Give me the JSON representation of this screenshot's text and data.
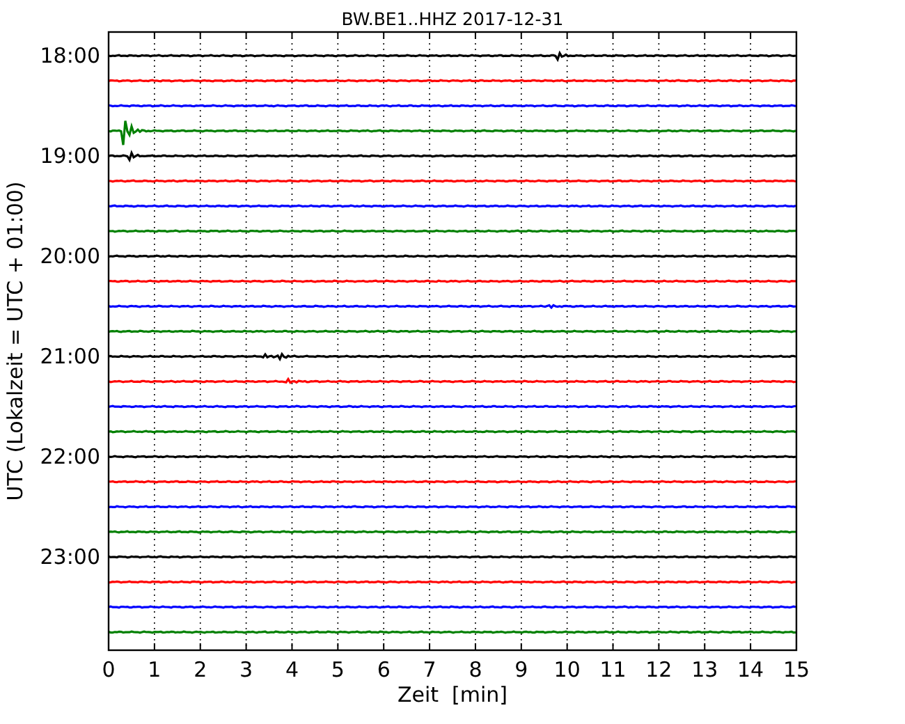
{
  "title": "BW.BE1..HHZ 2017-12-31",
  "ylabel": "UTC (Lokalzeit = UTC + 01:00)",
  "xlabel": "Zeit  [min]",
  "yticks": [
    "18:00",
    "19:00",
    "20:00",
    "21:00",
    "22:00",
    "23:00"
  ],
  "xticks": [
    "0",
    "1",
    "2",
    "3",
    "4",
    "5",
    "6",
    "7",
    "8",
    "9",
    "10",
    "11",
    "12",
    "13",
    "14",
    "15"
  ],
  "traces": [
    {
      "color": "#000000"
    },
    {
      "color": "#ff0000"
    },
    {
      "color": "#0000ff"
    },
    {
      "color": "#008000"
    },
    {
      "color": "#000000"
    },
    {
      "color": "#ff0000"
    },
    {
      "color": "#0000ff"
    },
    {
      "color": "#008000"
    },
    {
      "color": "#000000"
    },
    {
      "color": "#ff0000"
    },
    {
      "color": "#0000ff"
    },
    {
      "color": "#008000"
    },
    {
      "color": "#000000"
    },
    {
      "color": "#ff0000"
    },
    {
      "color": "#0000ff"
    },
    {
      "color": "#008000"
    },
    {
      "color": "#000000"
    },
    {
      "color": "#ff0000"
    },
    {
      "color": "#0000ff"
    },
    {
      "color": "#008000"
    },
    {
      "color": "#000000"
    },
    {
      "color": "#ff0000"
    },
    {
      "color": "#0000ff"
    },
    {
      "color": "#008000"
    }
  ]
}
